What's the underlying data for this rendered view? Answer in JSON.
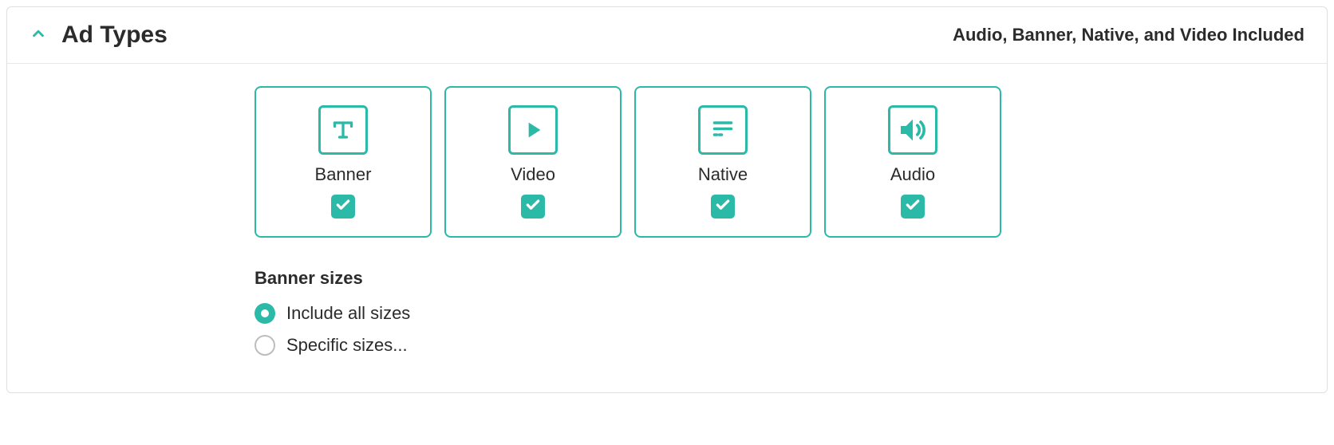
{
  "colors": {
    "accent": "#2bb9a8",
    "text": "#2b2b2b",
    "border": "#e0e0e0"
  },
  "panel": {
    "title": "Ad Types",
    "summary": "Audio, Banner, Native, and Video Included"
  },
  "cards": [
    {
      "label": "Banner",
      "icon": "text-icon",
      "checked": true
    },
    {
      "label": "Video",
      "icon": "play-icon",
      "checked": true
    },
    {
      "label": "Native",
      "icon": "list-icon",
      "checked": true
    },
    {
      "label": "Audio",
      "icon": "sound-icon",
      "checked": true
    }
  ],
  "bannerSizes": {
    "label": "Banner sizes",
    "options": [
      {
        "label": "Include all sizes",
        "checked": true
      },
      {
        "label": "Specific sizes...",
        "checked": false
      }
    ]
  }
}
